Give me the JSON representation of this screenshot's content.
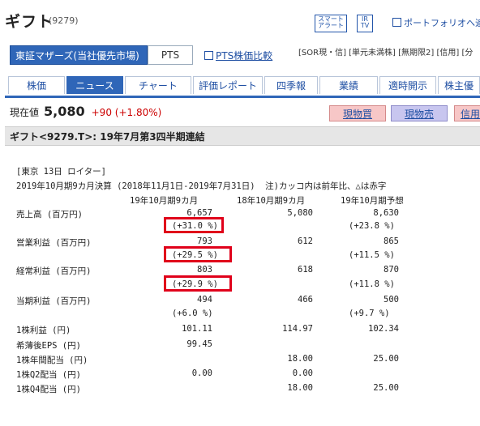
{
  "header": {
    "title": "ギフト",
    "code": "(9279)",
    "smart_alert": "スマート\nアラート",
    "ir_tv": "IR\nTV",
    "portfolio_link": "ポートフォリオへ追"
  },
  "market": {
    "selected": "東証マザーズ(当社優先市場)",
    "pts": "PTS",
    "pts_compare": "PTS株価比較",
    "flags": "[SOR現・信] [単元未満株] [無期限2] [信用] [分"
  },
  "tabs": [
    {
      "label": "株価",
      "active": false
    },
    {
      "label": "ニュース",
      "active": true
    },
    {
      "label": "チャート",
      "active": false
    },
    {
      "label": "評価レポート",
      "active": false
    },
    {
      "label": "四季報",
      "active": false
    },
    {
      "label": "業績",
      "active": false
    },
    {
      "label": "適時開示",
      "active": false
    },
    {
      "label": "株主優",
      "active": false
    }
  ],
  "price": {
    "label": "現在値",
    "value": "5,080",
    "change": "+90 (+1.80%)"
  },
  "actions": {
    "buy": "現物買",
    "sell": "現物売",
    "credit": "信用"
  },
  "news": {
    "headline": "ギフト<9279.T>: 19年7月第3四半期連結",
    "source": "[東京 13日 ロイター]",
    "period_line": "2019年10月期9カ月決算 (2018年11月1日-2019年7月31日)  注)カッコ内は前年比、△は赤字",
    "columns": [
      "19年10月期9カ月",
      "18年10月期9カ月",
      "19年10月期予想"
    ],
    "rows": [
      {
        "label": "売上高 (百万円)",
        "cur": "6,657",
        "prev": "5,080",
        "fcst": "8,630",
        "cur_pct": "(+31.0 %)",
        "fcst_pct": "(+23.8 %)"
      },
      {
        "label": "営業利益 (百万円)",
        "cur": "793",
        "prev": "612",
        "fcst": "865",
        "cur_pct": "(+29.5 %)",
        "fcst_pct": "(+11.5 %)"
      },
      {
        "label": "経常利益 (百万円)",
        "cur": "803",
        "prev": "618",
        "fcst": "870",
        "cur_pct": "(+29.9 %)",
        "fcst_pct": "(+11.8 %)"
      },
      {
        "label": "当期利益 (百万円)",
        "cur": "494",
        "prev": "466",
        "fcst": "500",
        "cur_pct": "(+6.0 %)",
        "fcst_pct": "(+9.7 %)"
      },
      {
        "label": "1株利益 (円)",
        "cur": "101.11",
        "prev": "114.97",
        "fcst": "102.34",
        "cur_pct": "",
        "fcst_pct": ""
      },
      {
        "label": "希薄後EPS (円)",
        "cur": "99.45",
        "prev": "",
        "fcst": "",
        "cur_pct": "",
        "fcst_pct": ""
      },
      {
        "label": "1株年間配当 (円)",
        "cur": "",
        "prev": "18.00",
        "fcst": "25.00",
        "cur_pct": "",
        "fcst_pct": ""
      },
      {
        "label": "1株Q2配当 (円)",
        "cur": "0.00",
        "prev": "0.00",
        "fcst": "",
        "cur_pct": "",
        "fcst_pct": ""
      },
      {
        "label": "1株Q4配当 (円)",
        "cur": "",
        "prev": "18.00",
        "fcst": "25.00",
        "cur_pct": "",
        "fcst_pct": ""
      }
    ]
  },
  "colors": {
    "accent": "#2f66b8",
    "link": "#1f4fa3",
    "up": "#cc0000",
    "highlight_box": "#e0001a"
  }
}
